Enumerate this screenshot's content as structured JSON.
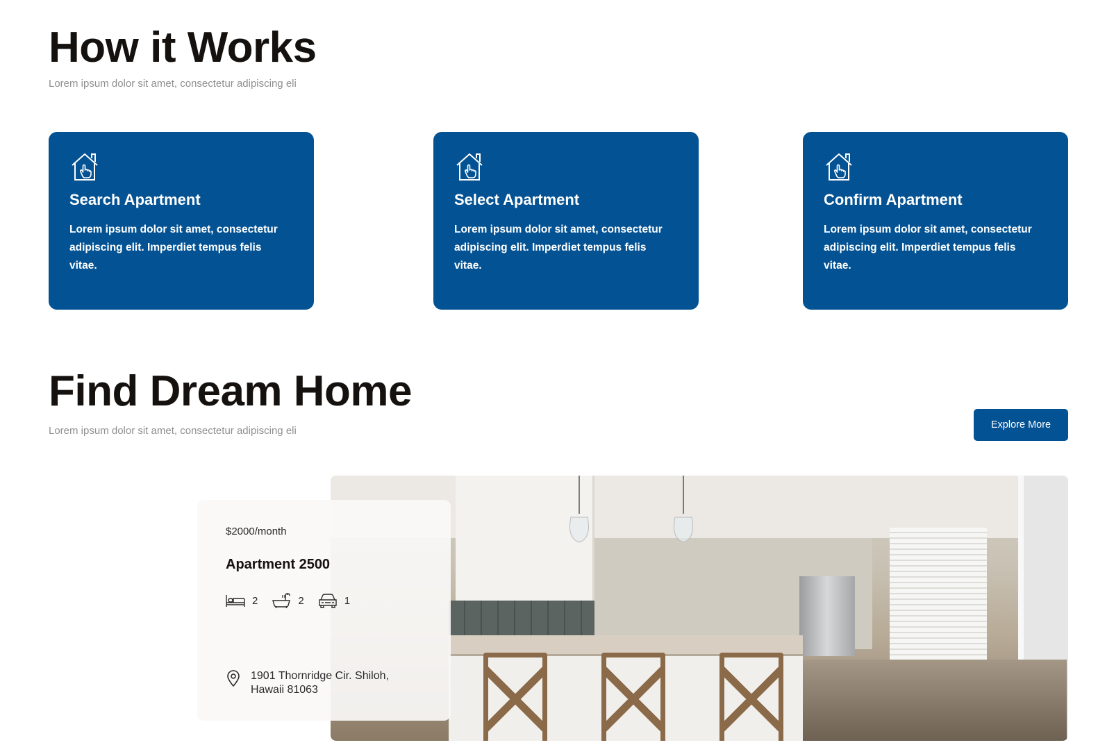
{
  "how_it_works": {
    "title": "How it Works",
    "subtitle": "Lorem ipsum dolor sit amet, consectetur adipiscing eli",
    "cards": [
      {
        "title": "Search Apartment",
        "text": "Lorem ipsum dolor sit amet, consectetur adipiscing elit. Imperdiet tempus felis vitae.",
        "icon": "house-pointer-icon"
      },
      {
        "title": "Select Apartment",
        "text": "Lorem ipsum dolor sit amet, consectetur adipiscing elit. Imperdiet tempus felis vitae.",
        "icon": "house-pointer-icon"
      },
      {
        "title": "Confirm Apartment",
        "text": "Lorem ipsum dolor sit amet, consectetur adipiscing elit. Imperdiet tempus felis vitae.",
        "icon": "house-pointer-icon"
      }
    ],
    "card_color": "#035293"
  },
  "find_home": {
    "title": "Find Dream Home",
    "subtitle": "Lorem ipsum dolor sit amet, consectetur adipiscing eli",
    "explore_label": "Explore More",
    "listing": {
      "price": "$2000/month",
      "name": "Apartment 2500",
      "bedrooms": "2",
      "bathrooms": "2",
      "parking": "1",
      "address": "1901 Thornridge Cir. Shiloh, Hawaii 81063",
      "photo": "kitchen-interior-photo"
    }
  },
  "colors": {
    "accent": "#035293",
    "heading": "#15110e",
    "muted": "#8f8f8f"
  }
}
